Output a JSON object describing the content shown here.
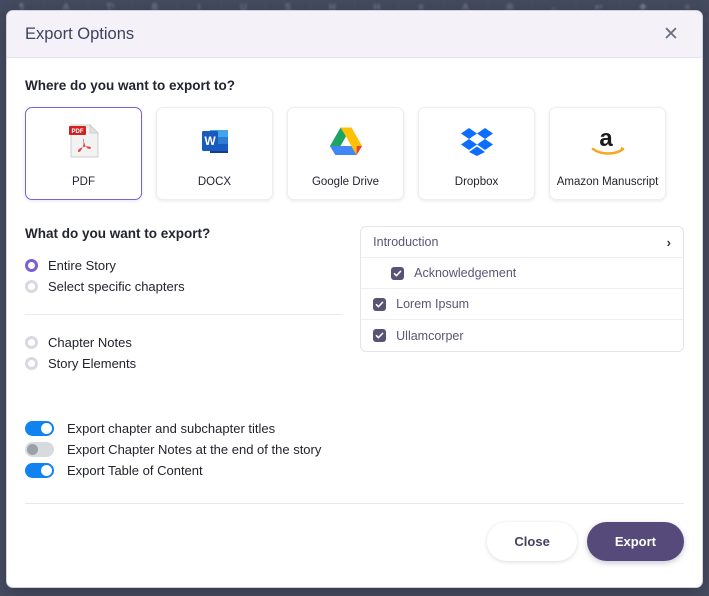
{
  "backdrop": {
    "toolbar_glyphs": [
      "¶",
      "A",
      "T¹",
      "B",
      "I",
      "U",
      "S",
      "H",
      "H",
      "≡",
      "A",
      "✇",
      "←",
      "↩",
      "❖",
      "⌗"
    ]
  },
  "modal": {
    "title": "Export Options",
    "close_icon": "✕"
  },
  "destination": {
    "heading": "Where do you want to export to?",
    "options": [
      {
        "label": "PDF",
        "icon": "pdf-icon",
        "selected": true
      },
      {
        "label": "DOCX",
        "icon": "word-docx-icon",
        "selected": false
      },
      {
        "label": "Google Drive",
        "icon": "google-drive-icon",
        "selected": false
      },
      {
        "label": "Dropbox",
        "icon": "dropbox-icon",
        "selected": false
      },
      {
        "label": "Amazon Manuscript",
        "icon": "amazon-icon",
        "selected": false
      }
    ]
  },
  "scope": {
    "heading": "What do you want to export?",
    "primary_options": [
      {
        "label": "Entire Story",
        "selected": true
      },
      {
        "label": "Select specific chapters",
        "selected": false
      }
    ],
    "secondary_options": [
      {
        "label": "Chapter Notes",
        "selected": false
      },
      {
        "label": "Story Elements",
        "selected": false
      }
    ]
  },
  "chapters": {
    "rows": [
      {
        "label": "Introduction",
        "type": "parent",
        "expand_icon": "›",
        "checked": false
      },
      {
        "label": "Acknowledgement",
        "type": "sub",
        "checked": true
      },
      {
        "label": "Lorem Ipsum",
        "type": "item",
        "checked": true
      },
      {
        "label": "Ullamcorper",
        "type": "item",
        "checked": true
      }
    ]
  },
  "toggles": [
    {
      "label": "Export chapter and subchapter titles",
      "on": true
    },
    {
      "label": "Export Chapter Notes at the end of the story",
      "on": false
    },
    {
      "label": "Export Table of Content",
      "on": true
    }
  ],
  "footer": {
    "close_label": "Close",
    "export_label": "Export"
  },
  "colors": {
    "accent_purple": "#7b5fd6",
    "button_purple": "#554a7a",
    "checkbox_purple": "#5a5275",
    "toggle_blue": "#1183f0",
    "header_bg": "#f4f2f8",
    "title_text": "#3d4260"
  }
}
